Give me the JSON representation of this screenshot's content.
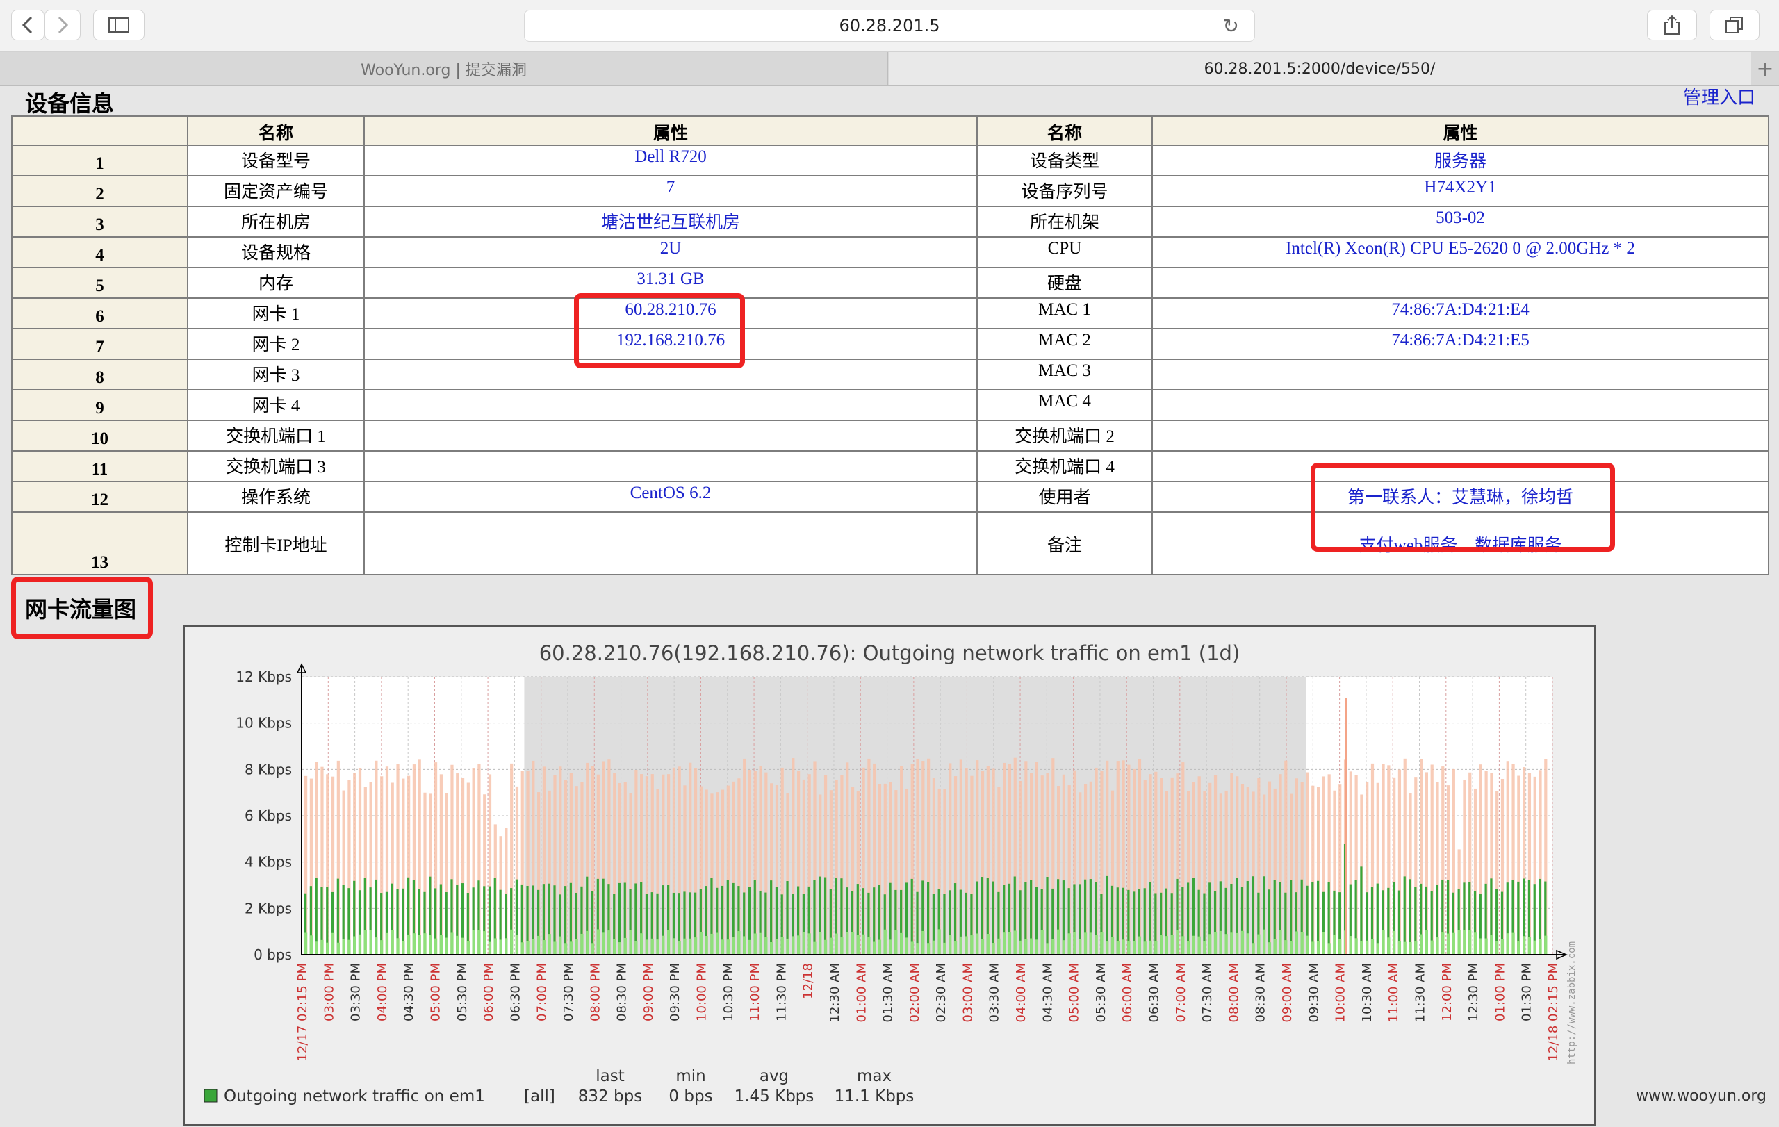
{
  "browser": {
    "url": "60.28.201.5",
    "tabs": [
      {
        "label": "WooYun.org | 提交漏洞"
      },
      {
        "label": "60.28.201.5:2000/device/550/"
      }
    ]
  },
  "page": {
    "device_section_title": "设备信息",
    "admin_link": "管理入口",
    "traffic_section_title": "网卡流量图",
    "watermark": "www.wooyun.org"
  },
  "table": {
    "headers": [
      "名称",
      "属性",
      "名称",
      "属性"
    ],
    "rows": [
      {
        "num": "1",
        "name1": "设备型号",
        "val1": "Dell R720",
        "name2": "设备类型",
        "val2": "服务器"
      },
      {
        "num": "2",
        "name1": "固定资产编号",
        "val1": "7",
        "name2": "设备序列号",
        "val2": "H74X2Y1"
      },
      {
        "num": "3",
        "name1": "所在机房",
        "val1": "塘沽世纪互联机房",
        "name2": "所在机架",
        "val2": "503-02"
      },
      {
        "num": "4",
        "name1": "设备规格",
        "val1": "2U",
        "name2": "CPU",
        "val2": "Intel(R) Xeon(R) CPU E5-2620 0 @ 2.00GHz * 2"
      },
      {
        "num": "5",
        "name1": "内存",
        "val1": "31.31 GB",
        "name2": "硬盘",
        "val2": ""
      },
      {
        "num": "6",
        "name1": "网卡 1",
        "val1": "60.28.210.76",
        "name2": "MAC 1",
        "val2": "74:86:7A:D4:21:E4"
      },
      {
        "num": "7",
        "name1": "网卡 2",
        "val1": "192.168.210.76",
        "name2": "MAC 2",
        "val2": "74:86:7A:D4:21:E5"
      },
      {
        "num": "8",
        "name1": "网卡 3",
        "val1": "",
        "name2": "MAC 3",
        "val2": ""
      },
      {
        "num": "9",
        "name1": "网卡 4",
        "val1": "",
        "name2": "MAC 4",
        "val2": ""
      },
      {
        "num": "10",
        "name1": "交换机端口 1",
        "val1": "",
        "name2": "交换机端口 2",
        "val2": ""
      },
      {
        "num": "11",
        "name1": "交换机端口 3",
        "val1": "",
        "name2": "交换机端口 4",
        "val2": ""
      },
      {
        "num": "12",
        "name1": "操作系统",
        "val1": "CentOS 6.2",
        "name2": "使用者",
        "val2": "第一联系人：艾慧琳，徐均哲"
      },
      {
        "num": "13",
        "name1": "控制卡IP地址",
        "val1": "",
        "name2": "备注",
        "val2": "支付web服务、数据库服务"
      }
    ]
  },
  "chart_data": {
    "type": "area",
    "title": "60.28.210.76(192.168.210.76): Outgoing network traffic on em1 (1d)",
    "y_ticks": [
      "12 Kbps",
      "10 Kbps",
      "8 Kbps",
      "6 Kbps",
      "4 Kbps",
      "2 Kbps",
      "0 bps"
    ],
    "ylim": [
      0,
      12
    ],
    "y_unit": "Kbps",
    "x_ticks": [
      {
        "label": "12/17 02:15 PM",
        "red": true
      },
      {
        "label": "03:00 PM",
        "red": true
      },
      {
        "label": "03:30 PM",
        "red": false
      },
      {
        "label": "04:00 PM",
        "red": true
      },
      {
        "label": "04:30 PM",
        "red": false
      },
      {
        "label": "05:00 PM",
        "red": true
      },
      {
        "label": "05:30 PM",
        "red": false
      },
      {
        "label": "06:00 PM",
        "red": true
      },
      {
        "label": "06:30 PM",
        "red": false
      },
      {
        "label": "07:00 PM",
        "red": true
      },
      {
        "label": "07:30 PM",
        "red": false
      },
      {
        "label": "08:00 PM",
        "red": true
      },
      {
        "label": "08:30 PM",
        "red": false
      },
      {
        "label": "09:00 PM",
        "red": true
      },
      {
        "label": "09:30 PM",
        "red": false
      },
      {
        "label": "10:00 PM",
        "red": true
      },
      {
        "label": "10:30 PM",
        "red": false
      },
      {
        "label": "11:00 PM",
        "red": true
      },
      {
        "label": "11:30 PM",
        "red": false
      },
      {
        "label": "12/18",
        "red": true
      },
      {
        "label": "12:30 AM",
        "red": false
      },
      {
        "label": "01:00 AM",
        "red": true
      },
      {
        "label": "01:30 AM",
        "red": false
      },
      {
        "label": "02:00 AM",
        "red": true
      },
      {
        "label": "02:30 AM",
        "red": false
      },
      {
        "label": "03:00 AM",
        "red": true
      },
      {
        "label": "03:30 AM",
        "red": false
      },
      {
        "label": "04:00 AM",
        "red": true
      },
      {
        "label": "04:30 AM",
        "red": false
      },
      {
        "label": "05:00 AM",
        "red": true
      },
      {
        "label": "05:30 AM",
        "red": false
      },
      {
        "label": "06:00 AM",
        "red": true
      },
      {
        "label": "06:30 AM",
        "red": false
      },
      {
        "label": "07:00 AM",
        "red": true
      },
      {
        "label": "07:30 AM",
        "red": false
      },
      {
        "label": "08:00 AM",
        "red": true
      },
      {
        "label": "08:30 AM",
        "red": false
      },
      {
        "label": "09:00 AM",
        "red": true
      },
      {
        "label": "09:30 AM",
        "red": false
      },
      {
        "label": "10:00 AM",
        "red": true
      },
      {
        "label": "10:30 AM",
        "red": false
      },
      {
        "label": "11:00 AM",
        "red": true
      },
      {
        "label": "11:30 AM",
        "red": false
      },
      {
        "label": "12:00 PM",
        "red": true
      },
      {
        "label": "12:30 PM",
        "red": false
      },
      {
        "label": "01:00 PM",
        "red": true
      },
      {
        "label": "01:30 PM",
        "red": false
      },
      {
        "label": "12/18 02:15 PM",
        "red": true
      }
    ],
    "series": [
      {
        "name": "Outgoing network traffic on em1",
        "color": "#3aa63a",
        "typical_kbps": 3.0,
        "peak_kbps": 11.1,
        "envelope_max_kbps": 8.5,
        "envelope_color": "#f7c3ac"
      }
    ],
    "legend": {
      "headers": [
        "last",
        "min",
        "avg",
        "max"
      ],
      "row": {
        "label": "Outgoing network traffic on em1",
        "scope": "[all]",
        "last": "832 bps",
        "min": "0 bps",
        "avg": "1.45 Kbps",
        "max": "11.1 Kbps"
      }
    },
    "side_text": "http://www.zabbix.com",
    "colors": {
      "axis_red": "#cc3333",
      "grid": "#cccccc",
      "night": "#dedede"
    }
  }
}
